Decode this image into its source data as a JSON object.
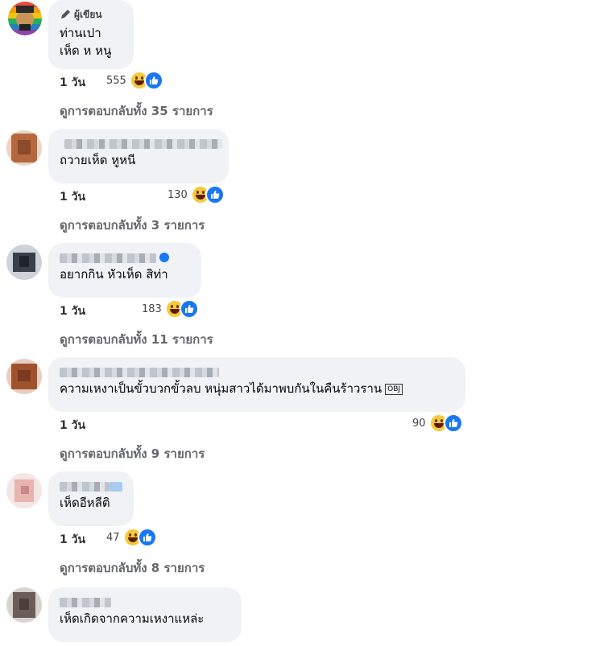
{
  "comments": [
    {
      "author_tag": "ผู้เขียน",
      "lines": [
        "ท่านเปา",
        "เห็ด ห หนู"
      ],
      "time": "1 วัน",
      "reaction_count": "555",
      "replies": "ดูการตอบกลับทั้ง 35 รายการ",
      "avatar_color": "#c0392b"
    },
    {
      "lines": [
        "ถวายเห็ด หูหนี"
      ],
      "time": "1 วัน",
      "reaction_count": "130",
      "replies": "ดูการตอบกลับทั้ง 3 รายการ",
      "avatar_color": "#b5683e"
    },
    {
      "lines": [
        "อยากกิน หัวเห็ด สิท่า"
      ],
      "time": "1 วัน",
      "reaction_count": "183",
      "replies": "ดูการตอบกลับทั้ง 11 รายการ",
      "avatar_color": "#3a3f4b"
    },
    {
      "lines": [
        "ความเหงาเป็นขั้วบวกขั้วลบ หนุ่มสาวได้มาพบกันในคืนร้าวราน"
      ],
      "obj": "OBJ",
      "time": "1 วัน",
      "reaction_count": "90",
      "replies": "ดูการตอบกลับทั้ง 9 รายการ",
      "avatar_color": "#a0522d"
    },
    {
      "lines": [
        "เห็ดอีหลีติ"
      ],
      "time": "1 วัน",
      "reaction_count": "47",
      "replies": "ดูการตอบกลับทั้ง 8 รายการ",
      "avatar_color": "#e8b4b0"
    },
    {
      "lines": [
        "เห็ดเกิดจากความเหงาแหล่ะ"
      ],
      "avatar_color": "#6b5d57"
    }
  ]
}
